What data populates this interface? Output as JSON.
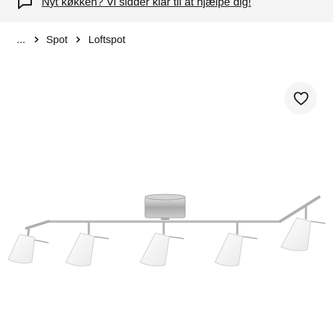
{
  "promo": {
    "text": "Nyt køkken? Vi sidder klar til at hjælpe dig!"
  },
  "breadcrumb": {
    "items": [
      "...",
      "Spot",
      "Loftspot"
    ]
  },
  "colors": {
    "promo_bg": "#f5f5f5",
    "text": "#111111",
    "fav_bg": "#f5f5f5"
  },
  "icons": {
    "promo": "speech-bubble-icon",
    "separator": "chevron-right-icon",
    "favourite": "heart-icon"
  }
}
